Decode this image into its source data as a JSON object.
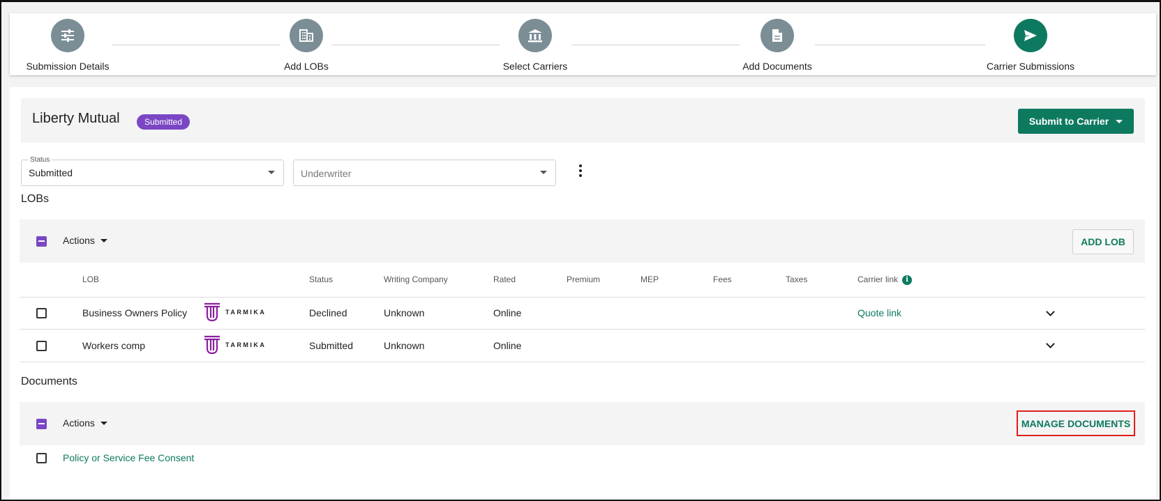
{
  "stepper": {
    "steps": [
      {
        "label": "Submission Details",
        "icon": "sliders-icon",
        "active": false
      },
      {
        "label": "Add LOBs",
        "icon": "building-icon",
        "active": false
      },
      {
        "label": "Select Carriers",
        "icon": "bank-icon",
        "active": false
      },
      {
        "label": "Add Documents",
        "icon": "document-icon",
        "active": false
      },
      {
        "label": "Carrier Submissions",
        "icon": "send-icon",
        "active": true
      }
    ]
  },
  "carrier": {
    "name": "Liberty Mutual",
    "status_badge": "Submitted",
    "submit_label": "Submit to Carrier"
  },
  "filters": {
    "status_label": "Status",
    "status_value": "Submitted",
    "underwriter_placeholder": "Underwriter"
  },
  "lobs": {
    "section_title": "LOBs",
    "actions_label": "Actions",
    "add_label": "ADD LOB",
    "columns": [
      "LOB",
      "Status",
      "Writing Company",
      "Rated",
      "Premium",
      "MEP",
      "Fees",
      "Taxes",
      "Carrier link"
    ],
    "rows": [
      {
        "lob": "Business Owners Policy",
        "logo_text": "TARMIKA",
        "status": "Declined",
        "writing_company": "Unknown",
        "rated": "Online",
        "carrier_link": "Quote link"
      },
      {
        "lob": "Workers comp",
        "logo_text": "TARMIKA",
        "status": "Submitted",
        "writing_company": "Unknown",
        "rated": "Online",
        "carrier_link": ""
      }
    ]
  },
  "documents": {
    "section_title": "Documents",
    "actions_label": "Actions",
    "manage_label": "MANAGE DOCUMENTS",
    "items": [
      {
        "name": "Policy or Service Fee Consent"
      }
    ]
  },
  "colors": {
    "accent_green": "#0d7a5f",
    "badge_purple": "#7a46c4",
    "step_grey": "#7b8e96",
    "highlight_red": "#e01e1e"
  }
}
